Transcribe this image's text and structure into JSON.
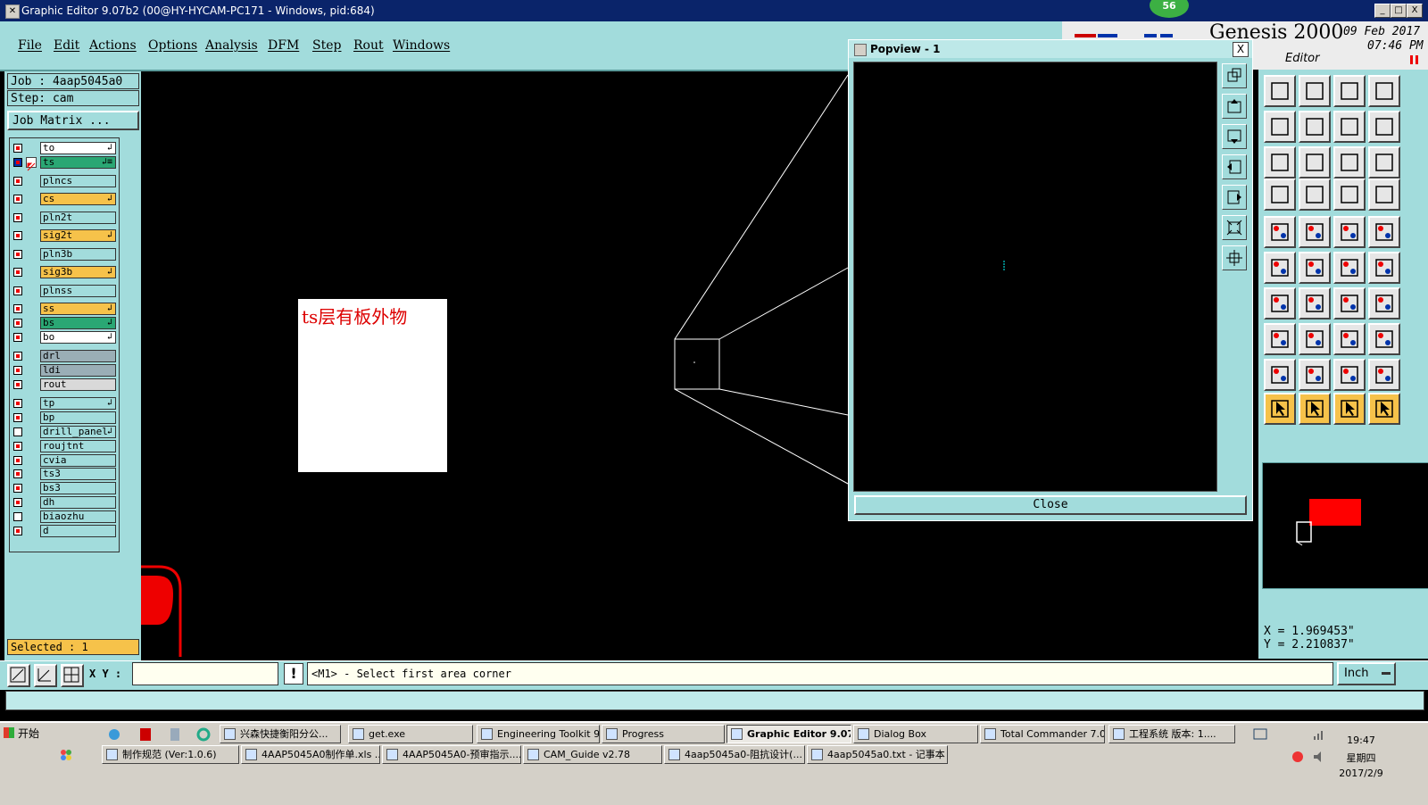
{
  "window": {
    "title": "Graphic Editor 9.07b2 (00@HY-HYCAM-PC171 - Windows, pid:684)",
    "notify_badge": "56",
    "minimize": "_",
    "maximize": "□",
    "close": "X"
  },
  "menu": [
    "File",
    "Edit",
    "Actions",
    "Options",
    "Analysis",
    "DFM",
    "Step",
    "Rout",
    "Windows"
  ],
  "genesis": {
    "logo": "Genesis 2000",
    "date": "09 Feb 2017",
    "time": "07:46 PM",
    "mode": "Editor"
  },
  "job": {
    "job_label": "Job : 4aap5045a0",
    "step_label": "Step: cam",
    "matrix_button": "Job Matrix ..."
  },
  "layers": [
    {
      "name": "to",
      "color": "#ffffff",
      "checked": true,
      "arrow": "↲"
    },
    {
      "name": "ts",
      "color": "#2aa774",
      "checked": true,
      "work": true,
      "arrow": "↲≡"
    },
    {
      "name": "plncs",
      "color": "#a2dcdc",
      "checked": true,
      "arrow": ""
    },
    {
      "name": "cs",
      "color": "#f6c24a",
      "checked": true,
      "arrow": "↲"
    },
    {
      "name": "pln2t",
      "color": "#a2dcdc",
      "checked": true,
      "arrow": ""
    },
    {
      "name": "sig2t",
      "color": "#f6c24a",
      "checked": true,
      "arrow": "↲"
    },
    {
      "name": "pln3b",
      "color": "#a2dcdc",
      "checked": true,
      "arrow": ""
    },
    {
      "name": "sig3b",
      "color": "#f6c24a",
      "checked": true,
      "arrow": "↲"
    },
    {
      "name": "plnss",
      "color": "#a2dcdc",
      "checked": true,
      "arrow": ""
    },
    {
      "name": "ss",
      "color": "#f6c24a",
      "checked": true,
      "arrow": "↲"
    },
    {
      "name": "bs",
      "color": "#2aa774",
      "checked": true,
      "arrow": "↲"
    },
    {
      "name": "bo",
      "color": "#ffffff",
      "checked": true,
      "arrow": "↲"
    },
    {
      "name": "drl",
      "color": "#9aaeb6",
      "checked": true,
      "arrow": ""
    },
    {
      "name": "ldi",
      "color": "#9aaeb6",
      "checked": true,
      "arrow": ""
    },
    {
      "name": "rout",
      "color": "#d9d9d9",
      "checked": true,
      "arrow": ""
    },
    {
      "name": "tp",
      "color": "#a2dcdc",
      "checked": true,
      "arrow": "↲"
    },
    {
      "name": "bp",
      "color": "#a2dcdc",
      "checked": true,
      "arrow": ""
    },
    {
      "name": "drill_panel",
      "color": "#a2dcdc",
      "checked": false,
      "arrow": "↲"
    },
    {
      "name": "roujtnt",
      "color": "#a2dcdc",
      "checked": true,
      "arrow": ""
    },
    {
      "name": "cvia",
      "color": "#a2dcdc",
      "checked": true,
      "arrow": ""
    },
    {
      "name": "ts3",
      "color": "#a2dcdc",
      "checked": true,
      "arrow": ""
    },
    {
      "name": "bs3",
      "color": "#a2dcdc",
      "checked": true,
      "arrow": ""
    },
    {
      "name": "dh",
      "color": "#a2dcdc",
      "checked": true,
      "arrow": ""
    },
    {
      "name": "biaozhu",
      "color": "#a2dcdc",
      "checked": false,
      "arrow": ""
    },
    {
      "name": "d",
      "color": "#a2dcdc",
      "checked": true,
      "arrow": ""
    }
  ],
  "selected": "Selected : 1",
  "annotation": "ts层有板外物",
  "popview": {
    "title": "Popview - 1",
    "close_x": "X",
    "close_button": "Close"
  },
  "coords": {
    "x": "X = 1.969453\"",
    "y": "Y = 2.210837\""
  },
  "statusbar": {
    "xy_label": "X Y :",
    "xy_value": "",
    "warn": "!",
    "prompt": "<M1> - Select first area corner",
    "units": "Inch"
  },
  "taskbar": {
    "start": "开始",
    "row1": [
      "兴森快捷衡阳分公...",
      "get.exe",
      "Engineering Toolkit 9....",
      "Progress",
      "Graphic Editor 9.07...",
      "Dialog Box",
      "Total Commander 7.0...",
      "工程系统  版本: 1...."
    ],
    "row2": [
      "制作规范 (Ver:1.0.6)",
      "4AAP5045A0制作单.xls ...",
      "4AAP5045A0-预审指示....",
      "CAM_Guide v2.78",
      "4aap5045a0-阻抗设计(...",
      "4aap5045a0.txt - 记事本"
    ],
    "time": "19:47",
    "weekday": "星期四",
    "date": "2017/2/9"
  },
  "colors": {
    "panel": "#a2dcdc",
    "titlebar": "#0a246a",
    "selected": "#f6c24a",
    "highlight": "#ff0000"
  }
}
